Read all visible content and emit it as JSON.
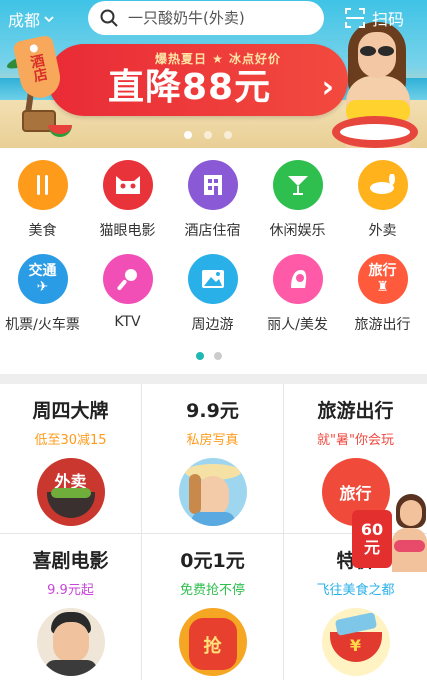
{
  "header": {
    "city": "成都",
    "search_placeholder": "一只酸奶牛(外卖)",
    "scan_label": "扫码"
  },
  "banner": {
    "tag_text": "酒店",
    "top_line": "爆热夏日 ★ 冰点好价",
    "main_text": "直降88元",
    "arrow": "›",
    "pager": {
      "count": 3,
      "active_index": 0
    }
  },
  "categories": [
    {
      "label": "美食",
      "icon": "fork-knife-icon",
      "color": "#ff9b1a",
      "glyph": "🍴"
    },
    {
      "label": "猫眼电影",
      "icon": "cat-eye-icon",
      "color": "#e8333b",
      "glyph": "🐱"
    },
    {
      "label": "酒店住宿",
      "icon": "hotel-icon",
      "color": "#8a5ad6",
      "glyph": "田"
    },
    {
      "label": "休闲娱乐",
      "icon": "cocktail-icon",
      "color": "#2fbf4f",
      "glyph": "🍸"
    },
    {
      "label": "外卖",
      "icon": "takeout-rabbit-icon",
      "color": "#ffb21c",
      "glyph": "🐇"
    },
    {
      "label": "机票/火车票",
      "icon": "plane-ticket-icon",
      "color": "#2a9be5",
      "glyph": "交通"
    },
    {
      "label": "KTV",
      "icon": "microphone-icon",
      "color": "#f24fb6",
      "glyph": "🎤"
    },
    {
      "label": "周边游",
      "icon": "landscape-icon",
      "color": "#2ab0e8",
      "glyph": "⛰"
    },
    {
      "label": "丽人/美发",
      "icon": "beauty-hair-icon",
      "color": "#ff5aa8",
      "glyph": "👩"
    },
    {
      "label": "旅游出行",
      "icon": "travel-icon",
      "color": "#ff5a3c",
      "glyph": "旅行"
    }
  ],
  "category_pager": {
    "count": 2,
    "active_index": 0
  },
  "deals": [
    {
      "title": "周四大牌",
      "subtitle": "低至30减15",
      "subtitle_color": "#ff9a1a",
      "image": "takeout-bowl-image",
      "image_text": "外卖",
      "image_bg": "#c9372e"
    },
    {
      "title": "9.9元",
      "subtitle": "私房写真",
      "subtitle_color": "#ff9a1a",
      "image": "portrait-photo-image",
      "image_text": "",
      "image_bg": "#9fd6ef"
    },
    {
      "title": "旅游出行",
      "subtitle": "就\"暑\"你会玩",
      "subtitle_color": "#f0483f",
      "image": "travel-badge-image",
      "image_text": "旅行",
      "image_bg": "#f04a3a"
    },
    {
      "title": "喜剧电影",
      "subtitle": "9.9元起",
      "subtitle_color": "#c645d8",
      "image": "comedian-image",
      "image_text": "",
      "image_bg": "#efe6d8"
    },
    {
      "title": "0元1元",
      "subtitle": "免费抢不停",
      "subtitle_color": "#2fbf4f",
      "image": "grab-bag-image",
      "image_text": "抢",
      "image_bg": "#f5a623"
    },
    {
      "title": "特价",
      "subtitle": "飞往美食之都",
      "subtitle_color": "#2ab0e8",
      "image": "food-bowl-image",
      "image_text": "¥",
      "image_bg": "#f7d24a"
    }
  ],
  "floating_badge": {
    "line1": "60",
    "line2": "元"
  }
}
